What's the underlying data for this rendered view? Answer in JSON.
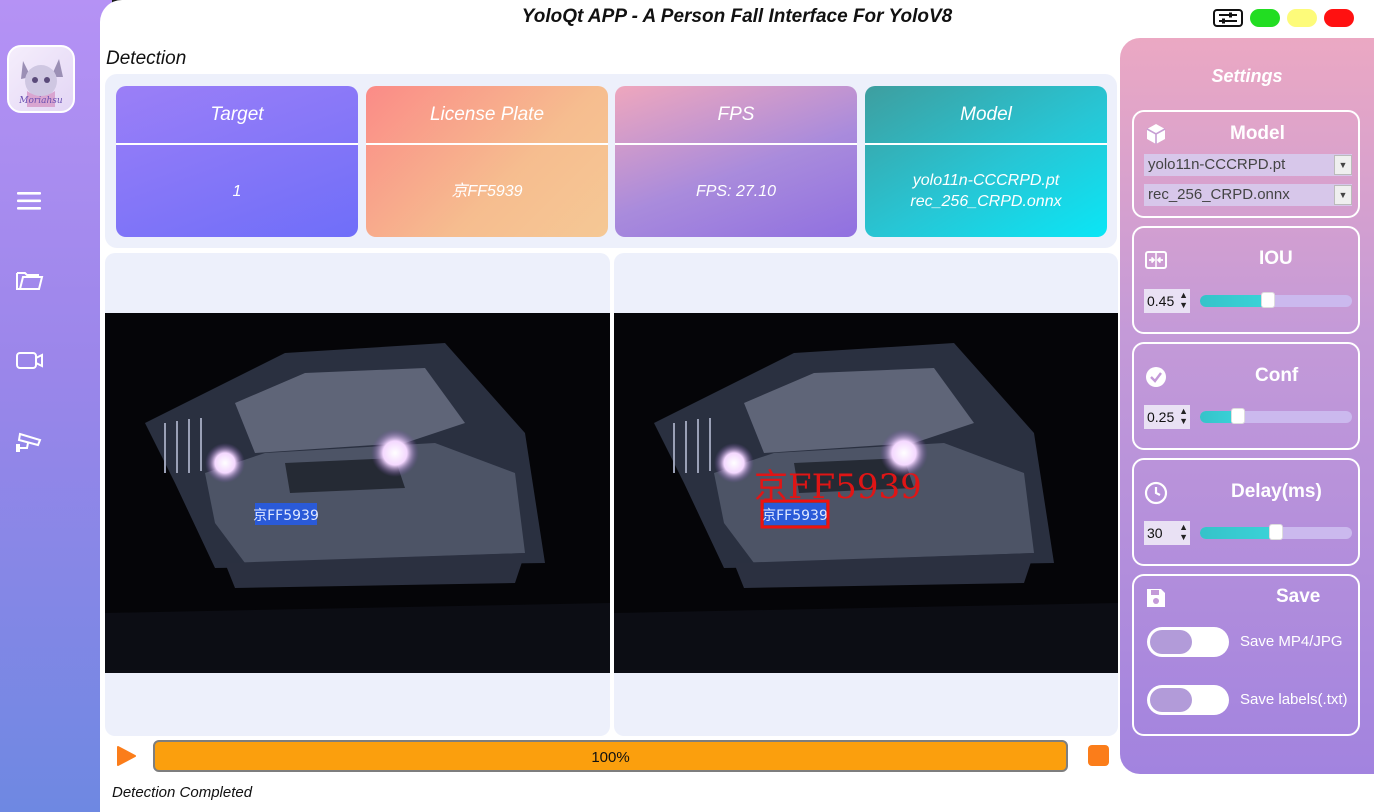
{
  "window": {
    "title": "YoloQt APP - A Person Fall Interface For YoloV8",
    "controls": {
      "settings_icon": "sliders-icon",
      "green": "#22dd22",
      "yellow": "#fdfb7a",
      "red": "#ff1111"
    }
  },
  "sidebar": {
    "avatar_text": "Moriahsu",
    "items": [
      {
        "icon": "menu-icon"
      },
      {
        "icon": "folder-icon"
      },
      {
        "icon": "camera-icon"
      },
      {
        "icon": "cctv-icon"
      }
    ]
  },
  "main": {
    "section_label": "Detection",
    "cards": [
      {
        "title": "Target",
        "value": "1"
      },
      {
        "title": "License Plate",
        "value": "京FF5939"
      },
      {
        "title": "FPS",
        "value": "FPS: 27.10"
      },
      {
        "title": "Model",
        "value_line1": "yolo11n-CCCRPD.pt",
        "value_line2": "rec_256_CRPD.onnx"
      }
    ],
    "original_plate_text": "京FF5939",
    "result_overlay_text": "京FF5939",
    "result_box_text": "京FF5939",
    "progress": {
      "percent": 100,
      "label": "100%"
    },
    "status": "Detection Completed"
  },
  "settings": {
    "title": "Settings",
    "model": {
      "label": "Model",
      "icon": "cube-icon",
      "detector_selected": "yolo11n-CCCRPD.pt",
      "recognizer_selected": "rec_256_CRPD.onnx"
    },
    "iou": {
      "label": "IOU",
      "icon": "merge-icon",
      "value": "0.45",
      "level": 0.45
    },
    "conf": {
      "label": "Conf",
      "icon": "check-circle-icon",
      "value": "0.25",
      "level": 0.25
    },
    "delay": {
      "label": "Delay(ms)",
      "icon": "clock-icon",
      "value": "30",
      "level": 0.5
    },
    "save": {
      "label": "Save",
      "icon": "floppy-icon",
      "options": [
        {
          "label": "Save MP4/JPG",
          "on": false
        },
        {
          "label": "Save labels(.txt)",
          "on": false
        }
      ]
    }
  }
}
